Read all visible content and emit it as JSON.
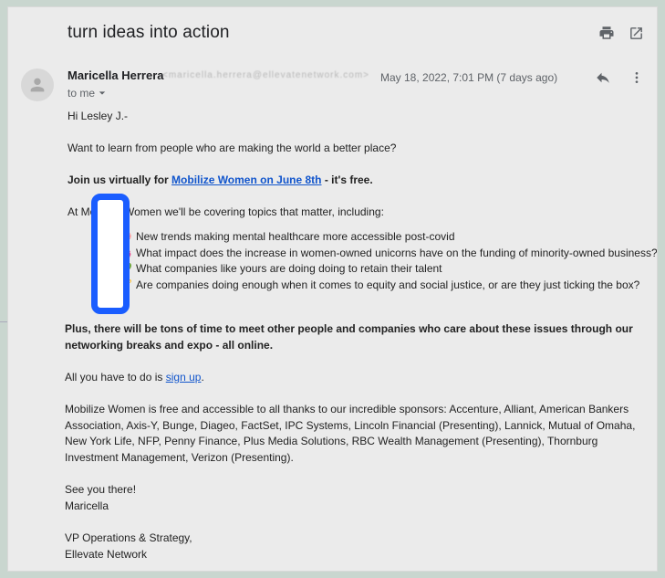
{
  "email": {
    "subject": "turn ideas into action",
    "sender_name": "Maricella Herrera",
    "sender_email_obscured": "<maricella.herrera@ellevatenetwork.com>",
    "to": "to me",
    "date": "May 18, 2022, 7:01 PM (7 days ago)"
  },
  "body": {
    "greeting": "Hi Lesley J.-",
    "intro": "Want to learn from people who are making the world a better place?",
    "join_prefix": "Join us virtually for ",
    "join_link": "Mobilize Women on June 8th",
    "join_suffix": " - it's free.",
    "topics_intro": "At Mobilize Women we'll be covering topics that matter, including:",
    "topics": [
      {
        "emoji": "🧠",
        "text": "New trends making mental healthcare more accessible post-covid"
      },
      {
        "emoji": "🦄",
        "text": "What impact does the increase in women-owned unicorns have on the funding of minority-owned business?"
      },
      {
        "emoji": "💚",
        "text": "What companies like yours are doing doing to retain their talent"
      },
      {
        "emoji": "🏆",
        "text": "Are companies doing enough when it comes to equity and social justice, or are they just ticking the box?"
      }
    ],
    "plus": "Plus, there will be tons of time to meet other people and companies who care about these issues through our networking breaks and expo - all online.",
    "signup_prefix": "All you have to do is ",
    "signup_link": "sign up",
    "signup_suffix": ".",
    "sponsors": "Mobilize Women is free and accessible to all thanks to our incredible sponsors: Accenture, Alliant, American Bankers Association, Axis-Y, Bunge, Diageo, FactSet, IPC Systems, Lincoln Financial (Presenting), Lannick, Mutual of Omaha, New York Life, NFP, Penny Finance, Plus Media Solutions, RBC Wealth Management (Presenting), Thornburg Investment Management, Verizon (Presenting).",
    "see_you": "See you there!",
    "signature_name": "Maricella",
    "signature_title": "VP Operations & Strategy,",
    "signature_org": "Ellevate Network"
  },
  "colors": {
    "link": "#1155cc",
    "highlight": "#1a5dff"
  }
}
